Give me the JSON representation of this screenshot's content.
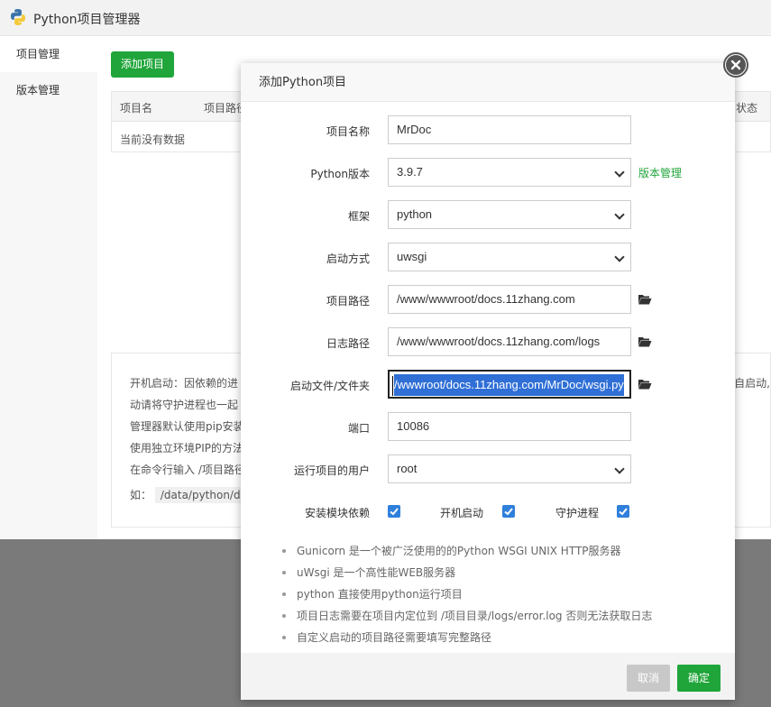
{
  "app": {
    "title": "Python项目管理器"
  },
  "sidebar": {
    "items": [
      {
        "label": "项目管理"
      },
      {
        "label": "版本管理"
      }
    ]
  },
  "main": {
    "add_button": "添加项目",
    "table": {
      "columns": [
        "项目名",
        "项目路径",
        "状态"
      ],
      "empty_text": "当前没有数据"
    },
    "notes": [
      "开机启动：因依赖的进",
      "动请将守护进程也一起",
      "管理器默认使用pip安装",
      "使用独立环境PIP的方法",
      "在命令行输入  /项目路径",
      "如：",
      "/data/python/d"
    ],
    "notes_right": "自启动,"
  },
  "dialog": {
    "title": "添加Python项目",
    "fields": {
      "name": {
        "label": "项目名称",
        "value": "MrDoc"
      },
      "python_version": {
        "label": "Python版本",
        "value": "3.9.7",
        "link": "版本管理"
      },
      "framework": {
        "label": "框架",
        "value": "python"
      },
      "start_mode": {
        "label": "启动方式",
        "value": "uwsgi"
      },
      "project_path": {
        "label": "项目路径",
        "value": "/www/wwwroot/docs.11zhang.com"
      },
      "log_path": {
        "label": "日志路径",
        "value": "/www/wwwroot/docs.11zhang.com/logs"
      },
      "startup_file": {
        "label": "启动文件/文件夹",
        "value": "/wwwroot/docs.11zhang.com/MrDoc/wsgi.py"
      },
      "port": {
        "label": "端口",
        "value": "10086"
      },
      "run_user": {
        "label": "运行项目的用户",
        "value": "root"
      }
    },
    "checkboxes": [
      {
        "label": "安装模块依赖",
        "checked": true
      },
      {
        "label": "开机启动",
        "checked": true
      },
      {
        "label": "守护进程",
        "checked": true
      }
    ],
    "tips": [
      "Gunicorn 是一个被广泛使用的的Python WSGI UNIX HTTP服务器",
      "uWsgi 是一个高性能WEB服务器",
      "python 直接使用python运行项目",
      "项目日志需要在项目内定位到 /项目目录/logs/error.log 否则无法获取日志",
      "自定义启动的项目路径需要填写完整路径"
    ],
    "buttons": {
      "cancel": "取消",
      "confirm": "确定"
    }
  },
  "colors": {
    "accent": "#20a53a",
    "checkbox": "#2f7fdc",
    "selection": "#2f6fd6"
  },
  "icons": [
    "python-logo-icon",
    "close-icon",
    "folder-open-icon",
    "check-icon",
    "chevron-down-icon"
  ]
}
